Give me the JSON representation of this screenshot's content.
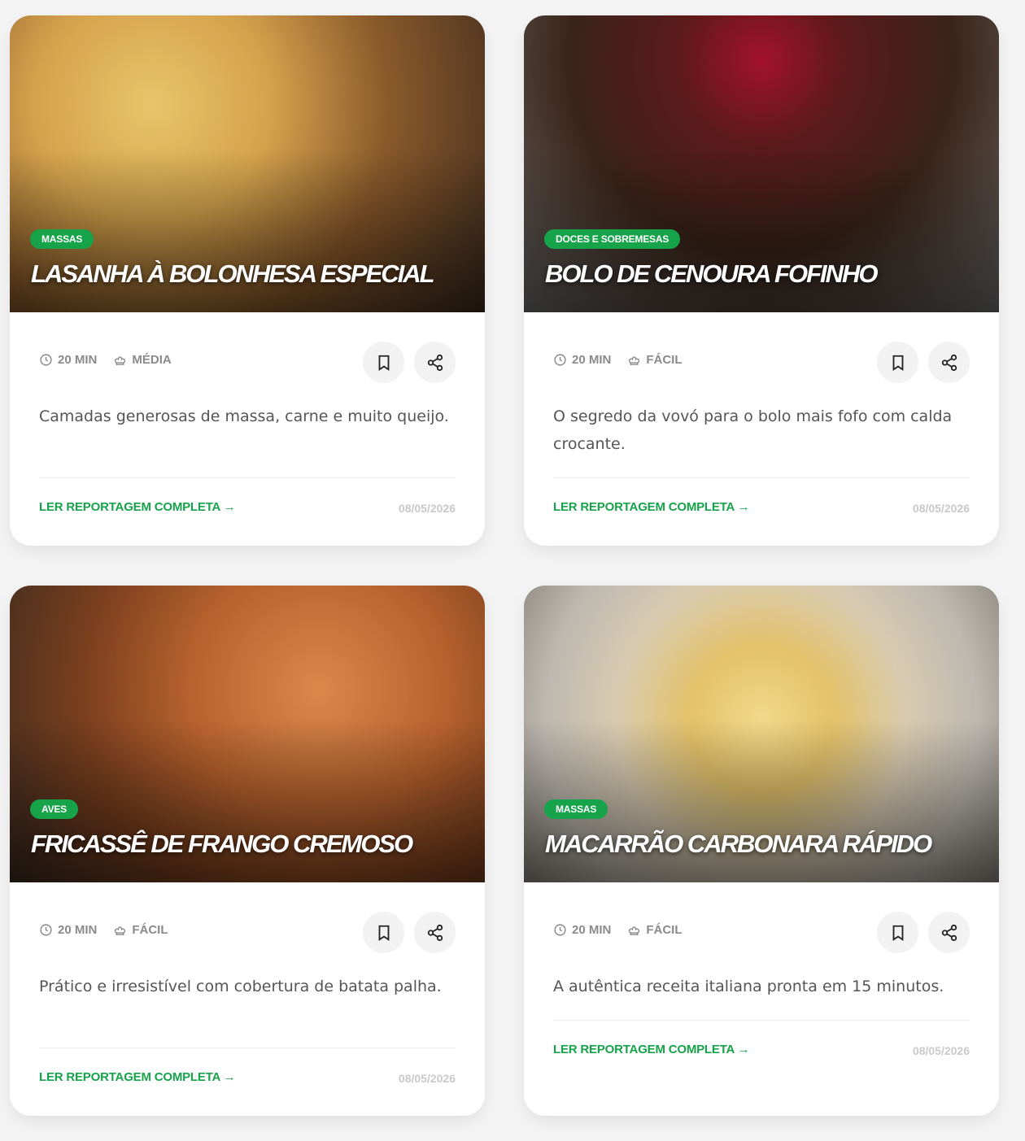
{
  "meta_labels": {
    "time_icon": "clock-icon",
    "difficulty_icon": "chef-hat-icon"
  },
  "accent_color": "#16a34a",
  "cards": [
    {
      "category": "MASSAS",
      "title": "LASANHA À BOLONHESA ESPECIAL",
      "time": "20 MIN",
      "difficulty": "MÉDIA",
      "description": "Camadas generosas de massa, carne e muito queijo.",
      "cta": "LER REPORTAGEM COMPLETA →",
      "date": "08/05/2026"
    },
    {
      "category": "DOCES E SOBREMESAS",
      "title": "BOLO DE CENOURA FOFINHO",
      "time": "20 MIN",
      "difficulty": "FÁCIL",
      "description": "O segredo da vovó para o bolo mais fofo com calda crocante.",
      "cta": "LER REPORTAGEM COMPLETA →",
      "date": "08/05/2026"
    },
    {
      "category": "AVES",
      "title": "FRICASSÊ DE FRANGO CREMOSO",
      "time": "20 MIN",
      "difficulty": "FÁCIL",
      "description": "Prático e irresistível com cobertura de batata palha.",
      "cta": "LER REPORTAGEM COMPLETA →",
      "date": "08/05/2026"
    },
    {
      "category": "MASSAS",
      "title": "MACARRÃO CARBONARA RÁPIDO",
      "time": "20 MIN",
      "difficulty": "FÁCIL",
      "description": "A autêntica receita italiana pronta em 15 minutos.",
      "cta": "LER REPORTAGEM COMPLETA →",
      "date": "08/05/2026"
    }
  ]
}
